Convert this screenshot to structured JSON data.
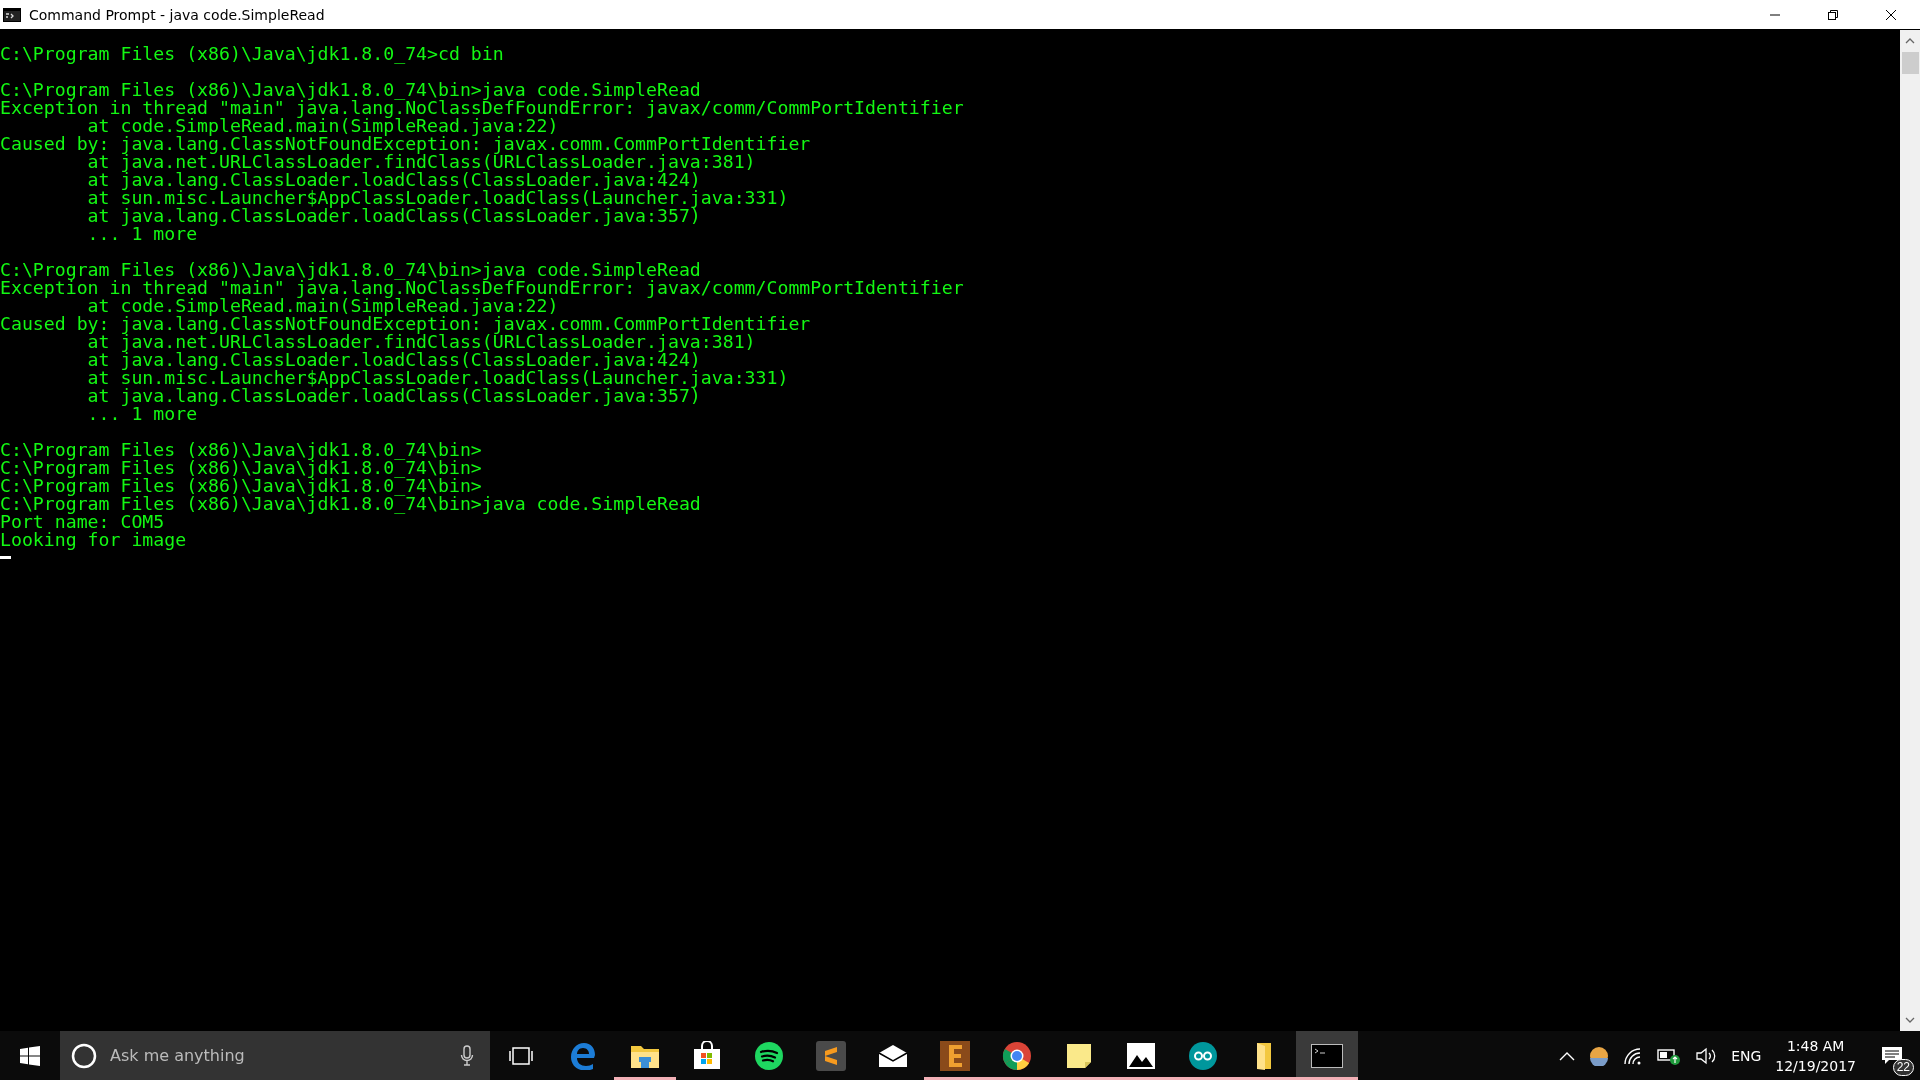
{
  "window": {
    "title": "Command Prompt - java  code.SimpleRead"
  },
  "console": {
    "blocks": [
      [
        "C:\\Program Files (x86)\\Java\\jdk1.8.0_74>cd bin"
      ],
      [
        "C:\\Program Files (x86)\\Java\\jdk1.8.0_74\\bin>java code.SimpleRead",
        "Exception in thread \"main\" java.lang.NoClassDefFoundError: javax/comm/CommPortIdentifier",
        "        at code.SimpleRead.main(SimpleRead.java:22)",
        "Caused by: java.lang.ClassNotFoundException: javax.comm.CommPortIdentifier",
        "        at java.net.URLClassLoader.findClass(URLClassLoader.java:381)",
        "        at java.lang.ClassLoader.loadClass(ClassLoader.java:424)",
        "        at sun.misc.Launcher$AppClassLoader.loadClass(Launcher.java:331)",
        "        at java.lang.ClassLoader.loadClass(ClassLoader.java:357)",
        "        ... 1 more"
      ],
      [
        "C:\\Program Files (x86)\\Java\\jdk1.8.0_74\\bin>java code.SimpleRead",
        "Exception in thread \"main\" java.lang.NoClassDefFoundError: javax/comm/CommPortIdentifier",
        "        at code.SimpleRead.main(SimpleRead.java:22)",
        "Caused by: java.lang.ClassNotFoundException: javax.comm.CommPortIdentifier",
        "        at java.net.URLClassLoader.findClass(URLClassLoader.java:381)",
        "        at java.lang.ClassLoader.loadClass(ClassLoader.java:424)",
        "        at sun.misc.Launcher$AppClassLoader.loadClass(Launcher.java:331)",
        "        at java.lang.ClassLoader.loadClass(ClassLoader.java:357)",
        "        ... 1 more"
      ],
      [
        "C:\\Program Files (x86)\\Java\\jdk1.8.0_74\\bin>",
        "C:\\Program Files (x86)\\Java\\jdk1.8.0_74\\bin>",
        "C:\\Program Files (x86)\\Java\\jdk1.8.0_74\\bin>",
        "C:\\Program Files (x86)\\Java\\jdk1.8.0_74\\bin>java code.SimpleRead",
        "Port name: COM5",
        "Looking for image"
      ]
    ]
  },
  "taskbar": {
    "search": {
      "placeholder": "Ask me anything"
    },
    "apps": [
      {
        "kind": "edge",
        "running": false,
        "selected": false
      },
      {
        "kind": "explorer",
        "running": true,
        "selected": false
      },
      {
        "kind": "store",
        "running": false,
        "selected": false
      },
      {
        "kind": "spotify",
        "running": false,
        "selected": false
      },
      {
        "kind": "sublime",
        "running": false,
        "selected": false
      },
      {
        "kind": "mail",
        "running": false,
        "selected": false
      },
      {
        "kind": "letter",
        "running": true,
        "selected": false
      },
      {
        "kind": "chrome",
        "running": true,
        "selected": false
      },
      {
        "kind": "notes",
        "running": true,
        "selected": false
      },
      {
        "kind": "photos",
        "running": true,
        "selected": false
      },
      {
        "kind": "arduino",
        "running": true,
        "selected": false
      },
      {
        "kind": "folder",
        "running": true,
        "selected": false
      },
      {
        "kind": "console",
        "running": true,
        "selected": true
      }
    ],
    "language": "ENG",
    "time": "1:48 AM",
    "date": "12/19/2017",
    "notification_count": "22"
  }
}
